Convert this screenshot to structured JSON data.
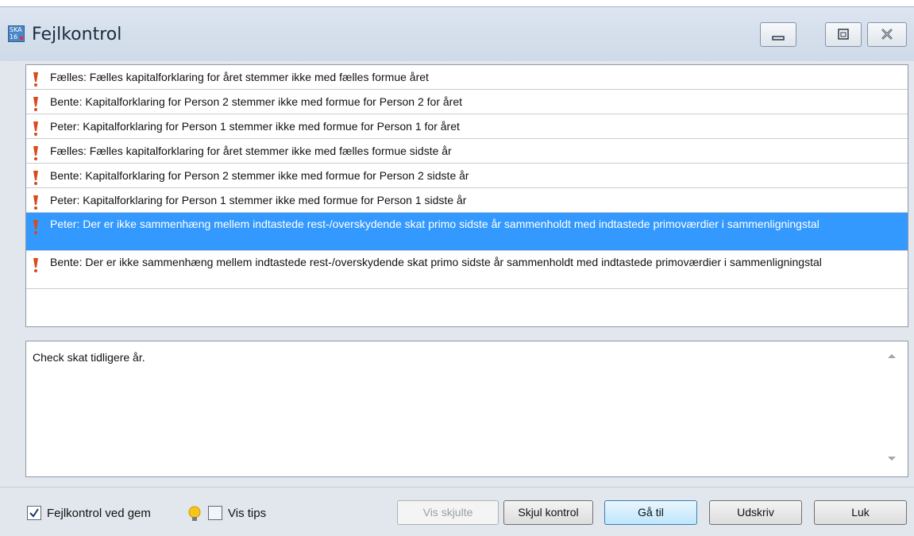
{
  "window": {
    "title": "Fejlkontrol",
    "icon_label": "SKA 16"
  },
  "errors": [
    {
      "text": "Fælles: Fælles kapitalforklaring for året stemmer ikke med fælles formue året"
    },
    {
      "text": "Bente: Kapitalforklaring for Person 2 stemmer ikke med formue for Person 2 for året"
    },
    {
      "text": "Peter: Kapitalforklaring for Person 1 stemmer ikke med formue for Person 1 for året"
    },
    {
      "text": "Fælles: Fælles kapitalforklaring for året stemmer ikke med fælles formue sidste år"
    },
    {
      "text": "Bente: Kapitalforklaring for Person 2 stemmer ikke med formue for Person 2 sidste år"
    },
    {
      "text": "Peter: Kapitalforklaring for Person 1 stemmer ikke med formue for Person 1 sidste år"
    },
    {
      "text": "Peter: Der er ikke sammenhæng mellem indtastede rest-/overskydende skat primo sidste år sammenholdt med indtastede primoværdier i sammenligningstal"
    },
    {
      "text": "Bente: Der er ikke sammenhæng mellem indtastede rest-/overskydende skat primo sidste år sammenholdt med indtastede primoværdier i sammenligningstal"
    }
  ],
  "detail": {
    "text": "Check skat tidligere år."
  },
  "footer": {
    "check_on_save_label": "Fejlkontrol ved gem",
    "show_tips_label": "Vis tips",
    "buttons": {
      "show_hidden": "Vis skjulte",
      "hide_check": "Skjul kontrol",
      "goto": "Gå til",
      "print": "Udskriv",
      "close": "Luk"
    }
  },
  "colors": {
    "selection": "#3399ff",
    "warning": "#d94a1e"
  }
}
